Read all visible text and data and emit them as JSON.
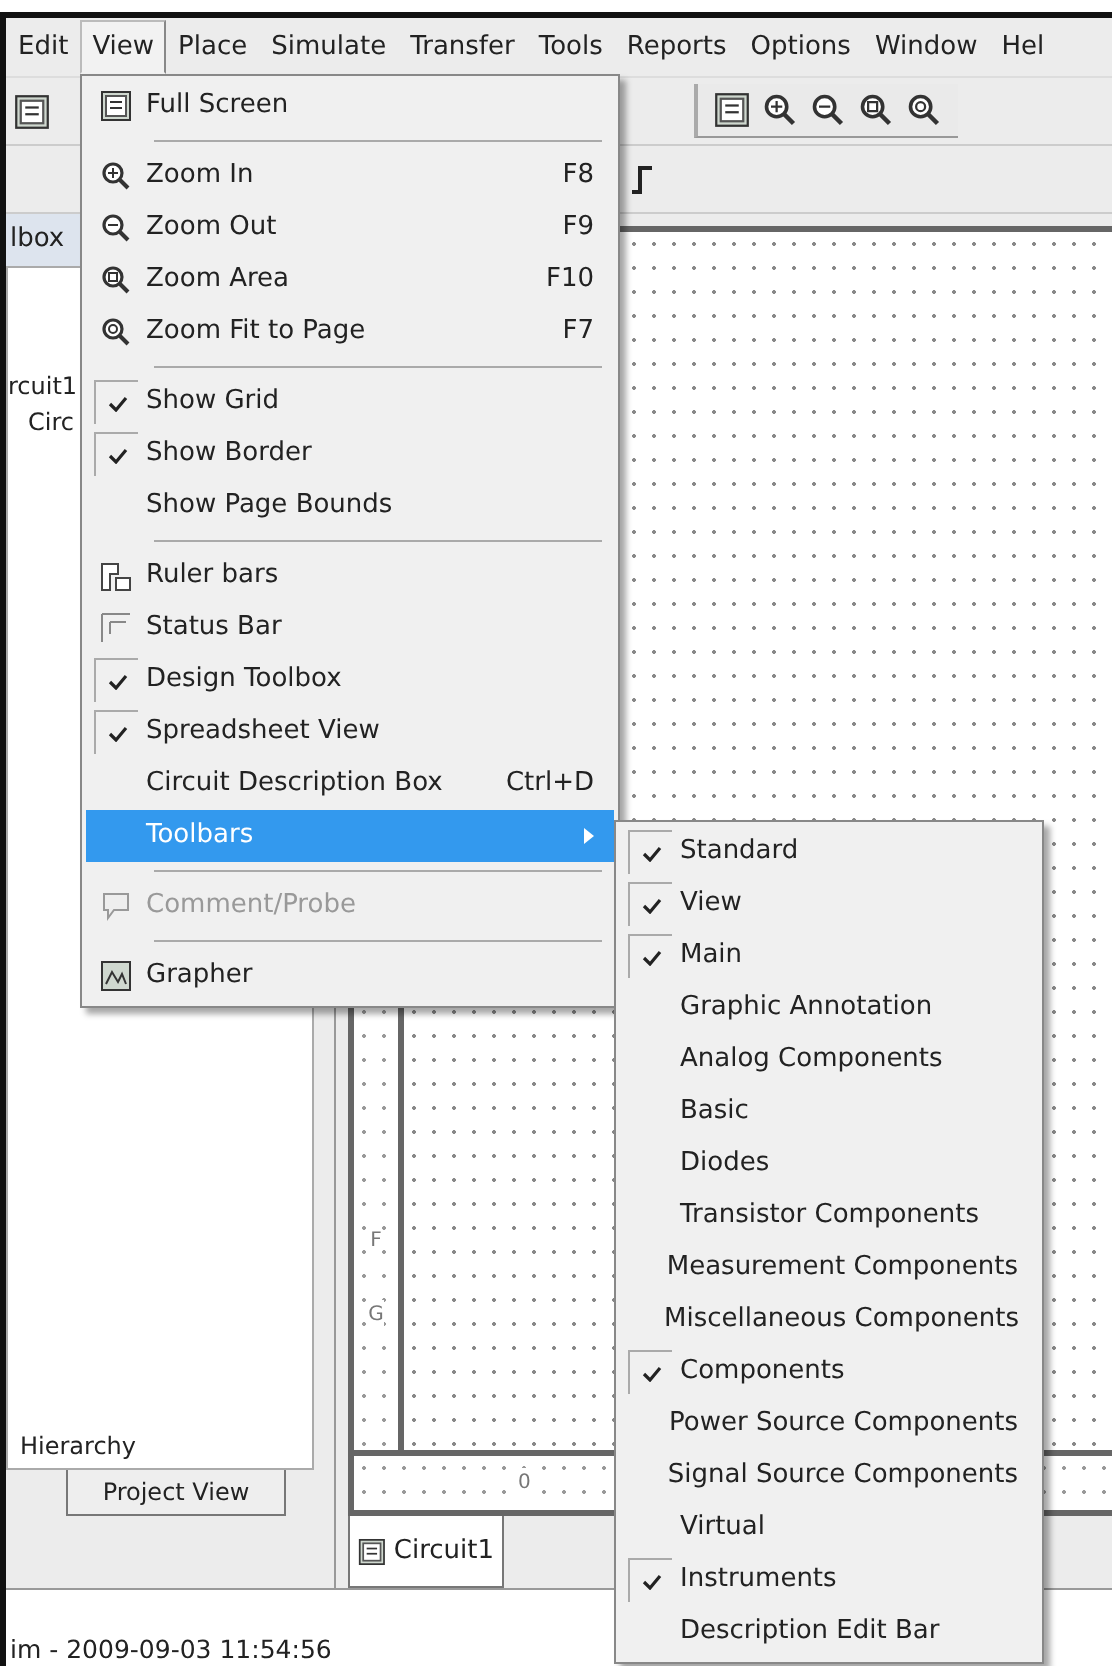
{
  "menubar": [
    {
      "label": "Edit",
      "selected": false
    },
    {
      "label": "View",
      "selected": true
    },
    {
      "label": "Place",
      "selected": false
    },
    {
      "label": "Simulate",
      "selected": false
    },
    {
      "label": "Transfer",
      "selected": false
    },
    {
      "label": "Tools",
      "selected": false
    },
    {
      "label": "Reports",
      "selected": false
    },
    {
      "label": "Options",
      "selected": false
    },
    {
      "label": "Window",
      "selected": false
    },
    {
      "label": "Hel",
      "selected": false
    }
  ],
  "left_panel": {
    "tab": "lbox",
    "tree": [
      "rcuit1",
      "Circ"
    ],
    "footer": "Hierarchy",
    "bottom_tab": "Project View"
  },
  "canvas": {
    "ruler_labels": [
      "F",
      "G"
    ],
    "bottom_ruler_label": "0",
    "document_tab": "Circuit1"
  },
  "view_menu": [
    {
      "kind": "icon",
      "label": "Full Screen"
    },
    {
      "kind": "separator"
    },
    {
      "kind": "icon",
      "label": "Zoom In",
      "shortcut": "F8"
    },
    {
      "kind": "icon",
      "label": "Zoom Out",
      "shortcut": "F9"
    },
    {
      "kind": "icon",
      "label": "Zoom Area",
      "shortcut": "F10"
    },
    {
      "kind": "icon",
      "label": "Zoom Fit to Page",
      "shortcut": "F7"
    },
    {
      "kind": "separator"
    },
    {
      "kind": "check",
      "label": "Show Grid",
      "checked": true
    },
    {
      "kind": "check",
      "label": "Show Border",
      "checked": true
    },
    {
      "kind": "check",
      "label": "Show Page Bounds",
      "checked": false
    },
    {
      "kind": "separator"
    },
    {
      "kind": "icon",
      "label": "Ruler bars"
    },
    {
      "kind": "icon",
      "label": "Status Bar"
    },
    {
      "kind": "check",
      "label": "Design Toolbox",
      "checked": true
    },
    {
      "kind": "check",
      "label": "Spreadsheet View",
      "checked": true
    },
    {
      "kind": "check",
      "label": "Circuit Description Box",
      "checked": false,
      "shortcut": "Ctrl+D"
    },
    {
      "kind": "submenu",
      "label": "Toolbars",
      "selected": true
    },
    {
      "kind": "separator"
    },
    {
      "kind": "icon",
      "label": "Comment/Probe",
      "disabled": true
    },
    {
      "kind": "separator"
    },
    {
      "kind": "icon",
      "label": "Grapher"
    }
  ],
  "toolbars_submenu": [
    {
      "label": "Standard",
      "checked": true
    },
    {
      "label": "View",
      "checked": true
    },
    {
      "label": "Main",
      "checked": true
    },
    {
      "label": "Graphic Annotation",
      "checked": false
    },
    {
      "label": "Analog Components",
      "checked": false
    },
    {
      "label": "Basic",
      "checked": false
    },
    {
      "label": "Diodes",
      "checked": false
    },
    {
      "label": "Transistor Components",
      "checked": false
    },
    {
      "label": "Measurement Components",
      "checked": false
    },
    {
      "label": "Miscellaneous Components",
      "checked": false
    },
    {
      "label": "Components",
      "checked": true
    },
    {
      "label": "Power Source Components",
      "checked": false
    },
    {
      "label": "Signal Source Components",
      "checked": false
    },
    {
      "label": "Virtual",
      "checked": false
    },
    {
      "label": "Instruments",
      "checked": true
    },
    {
      "label": "Description Edit Bar",
      "checked": false
    }
  ],
  "status_bar": "im  -  2009-09-03 11:54:56"
}
